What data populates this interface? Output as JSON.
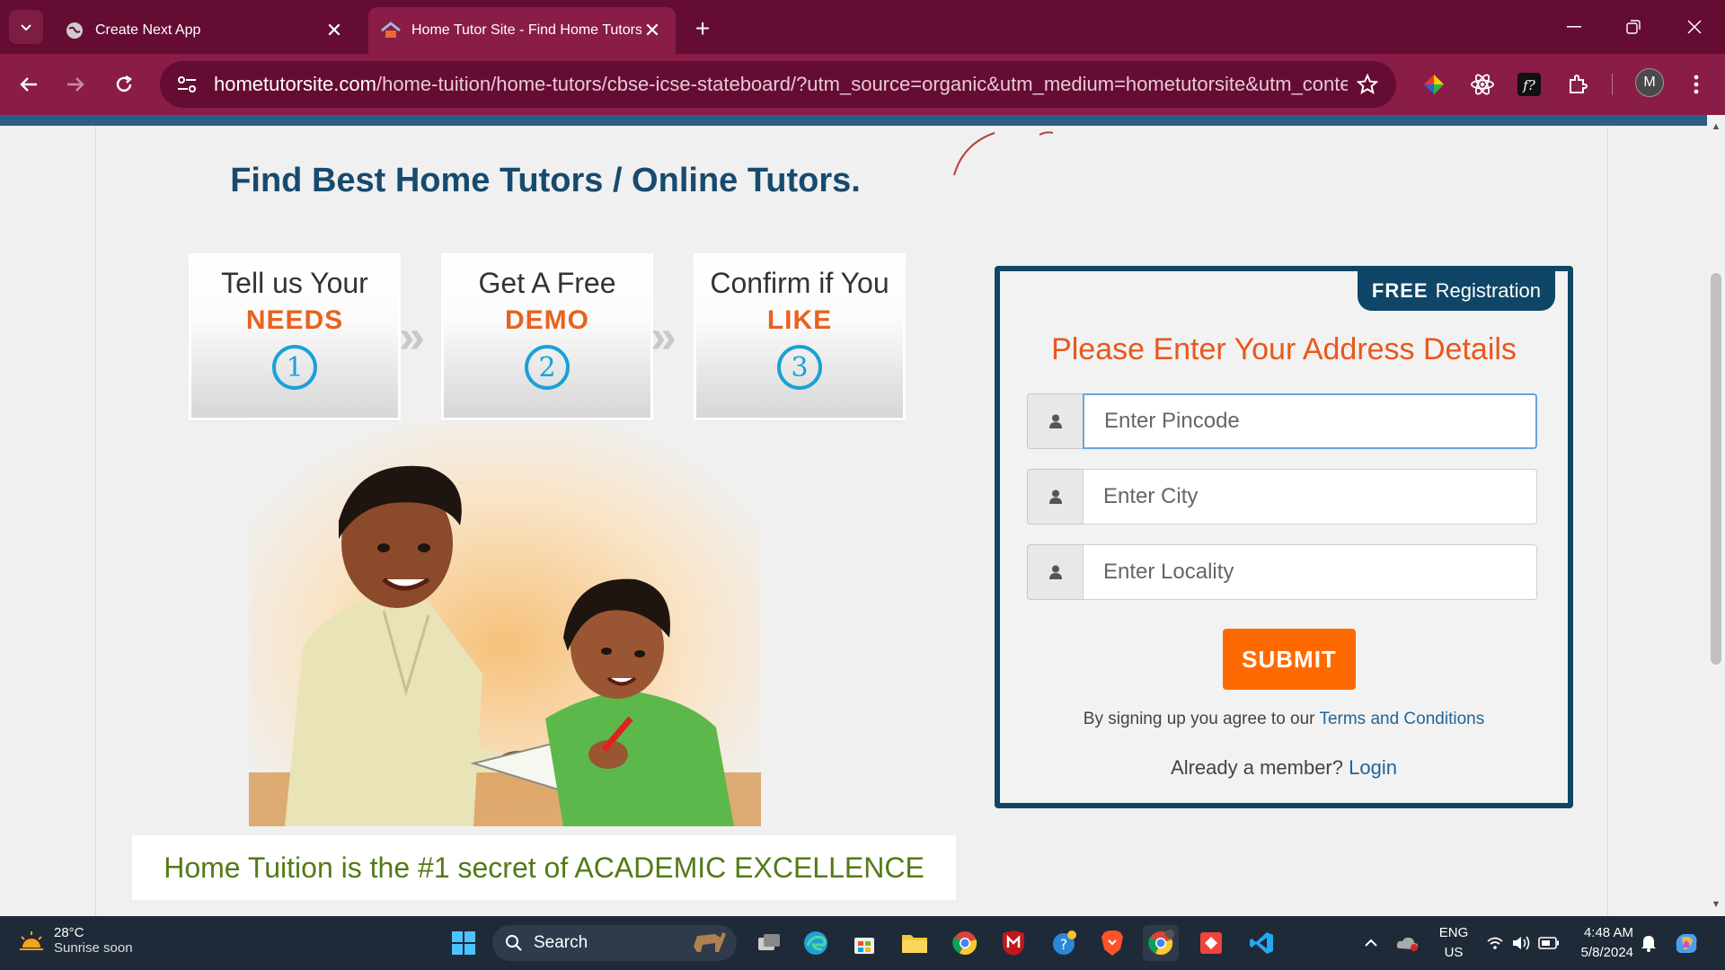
{
  "browser": {
    "tabs": [
      {
        "title": "Create Next App",
        "active": false
      },
      {
        "title": "Home Tutor Site - Find Home Tutors, I",
        "active": true
      }
    ],
    "url_domain": "hometutorsite.com",
    "url_path": "/home-tuition/home-tutors/cbse-icse-stateboard/?utm_source=organic&utm_medium=hometutorsite&utm_content=...",
    "profile_initial": "M",
    "icons": [
      "tab-search-icon",
      "close-icon",
      "plus-icon",
      "minimize-icon",
      "restore-icon",
      "back-icon",
      "forward-icon",
      "reload-icon",
      "site-settings-icon",
      "star-icon",
      "extension-icon",
      "more-icon"
    ]
  },
  "page": {
    "heading": "Find Best Home Tutors / Online Tutors.",
    "steps": [
      {
        "line1": "Tell us Your",
        "line2": "NEEDS",
        "number": "1"
      },
      {
        "line1": "Get A Free",
        "line2": "DEMO",
        "number": "2"
      },
      {
        "line1": "Confirm if You",
        "line2": "LIKE",
        "number": "3"
      }
    ],
    "step_arrow": "»",
    "tagline": "Home Tuition is the #1 secret of ACADEMIC EXCELLENCE",
    "form": {
      "badge_bold": "FREE",
      "badge_text": "Registration",
      "title": "Please Enter Your Address Details",
      "fields": [
        {
          "placeholder": "Enter Pincode",
          "value": ""
        },
        {
          "placeholder": "Enter City",
          "value": ""
        },
        {
          "placeholder": "Enter Locality",
          "value": ""
        }
      ],
      "submit_label": "SUBMIT",
      "terms_prefix": "By signing up you agree to our",
      "terms_link": "Terms and Conditions",
      "member_prefix": "Already a member?",
      "login_link": "Login"
    },
    "colors": {
      "heading": "#174a6e",
      "accent_orange": "#e8621e",
      "form_border": "#0f4566",
      "submit": "#ff6a00",
      "tagline": "#547a17",
      "browser_theme": "#8a1c48"
    }
  },
  "taskbar": {
    "weather_temp": "28°C",
    "weather_desc": "Sunrise soon",
    "search_label": "Search",
    "lang_line1": "ENG",
    "lang_line2": "US",
    "time": "4:48 AM",
    "date": "5/8/2024"
  }
}
